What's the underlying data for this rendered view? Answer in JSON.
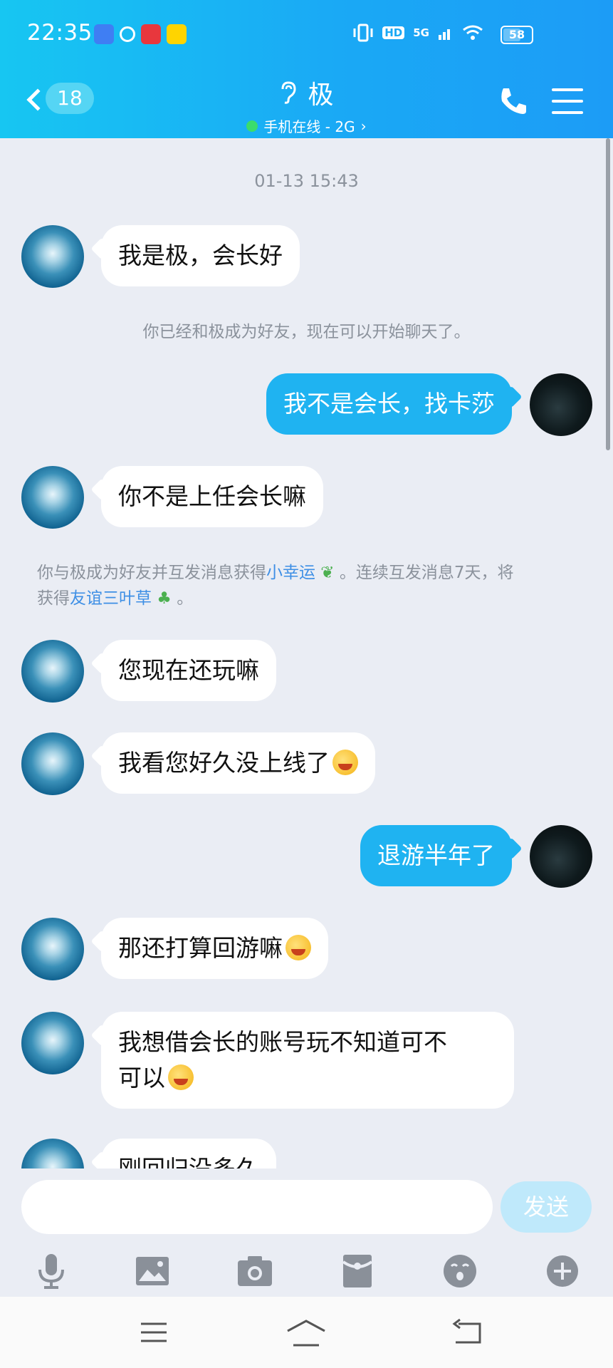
{
  "status_bar": {
    "time": "22:35",
    "network": "5G",
    "hd": "HD",
    "battery": "58",
    "battery_level": 0.58
  },
  "header": {
    "unread_count": "18",
    "contact_name": "极",
    "presence": "手机在线 - 2G",
    "presence_color": "#3bdc6c",
    "gradient_from": "#17c6f2",
    "gradient_to": "#1c9cf6"
  },
  "chat": {
    "timestamp": "01-13 15:43",
    "messages": [
      {
        "from": "other",
        "text": "我是极，会长好"
      },
      {
        "from": "self",
        "text": "我不是会长，找卡莎"
      },
      {
        "from": "other",
        "text": "你不是上任会长嘛"
      },
      {
        "from": "other",
        "text": "您现在还玩嘛"
      },
      {
        "from": "other",
        "text": "我看您好久没上线了",
        "emoji": "laugh-cry-emoji"
      },
      {
        "from": "self",
        "text": "退游半年了"
      },
      {
        "from": "other",
        "text": "那还打算回游嘛",
        "emoji": "laugh-cry-emoji"
      },
      {
        "from": "other",
        "text_line1": "我想借会长的账号玩不知道可不",
        "text_line2": "可以",
        "emoji": "laugh-cry-emoji"
      },
      {
        "from": "other",
        "text": "刚回归没多久"
      }
    ],
    "system_friend": "你已经和极成为好友，现在可以开始聊天了。",
    "system_luck": {
      "part1": "你与极成为好友并互发消息获得",
      "link1": "小幸运",
      "part2": "。连续互发消息7天，将",
      "part3": "获得",
      "link2": "友谊三叶草",
      "part4": "。"
    },
    "self_bubble_color": "#1fb3f1"
  },
  "input": {
    "placeholder": "",
    "send_label": "发送"
  },
  "toolbar_icons": [
    "microphone-icon",
    "image-icon",
    "camera-icon",
    "red-packet-icon",
    "emoji-icon",
    "plus-icon"
  ]
}
